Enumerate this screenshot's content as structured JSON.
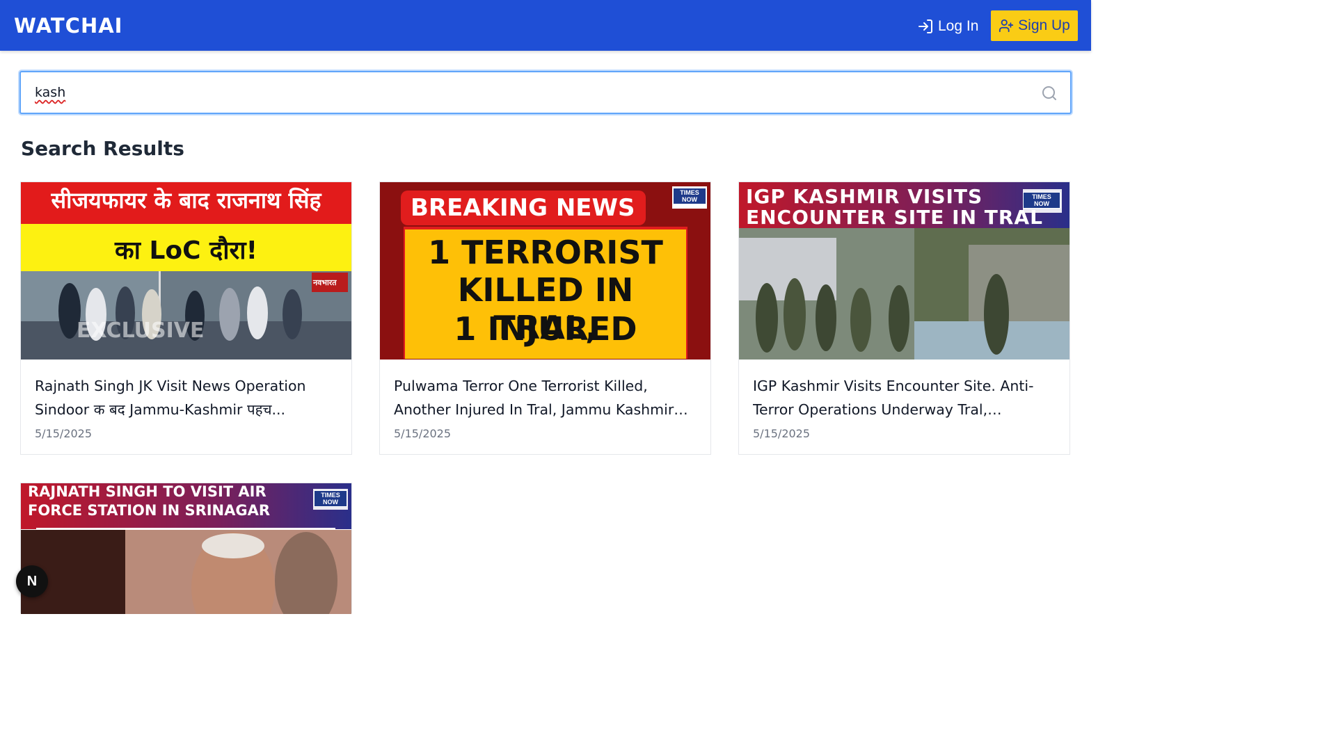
{
  "header": {
    "brand": "WATCHAI",
    "login_label": "Log In",
    "signup_label": "Sign Up"
  },
  "search": {
    "value": "kash",
    "placeholder": ""
  },
  "results_title": "Search Results",
  "results": [
    {
      "title": "Rajnath Singh JK Visit News Operation Sindoor क बद Jammu-Kashmir पहच...",
      "date": "5/15/2025",
      "thumb_line1": "सीजयफायर के बाद राजनाथ सिंह",
      "thumb_line2": "का LoC दौरा!",
      "thumb_watermark": "EXCLUSIVE",
      "thumb_logo": "नवभारत"
    },
    {
      "title": "Pulwama Terror One Terrorist Killed, Another Injured In Tral, Jammu Kashmir B...",
      "date": "5/15/2025",
      "thumb_banner": "BREAKING NEWS",
      "thumb_line1": "1 TERRORIST",
      "thumb_line2": "KILLED IN TRAL,",
      "thumb_line3": "1 INJURED",
      "thumb_logo": "TIMES NOW"
    },
    {
      "title": "IGP Kashmir Visits Encounter Site. Anti-Terror Operations Underway Tral, Pulwama.",
      "date": "5/15/2025",
      "thumb_line1": "IGP KASHMIR VISITS",
      "thumb_line2": "ENCOUNTER SITE IN TRAL",
      "thumb_logo": "TIMES NOW"
    },
    {
      "title": "",
      "date": "",
      "thumb_line1": "RAJNATH SINGH TO VISIT AIR",
      "thumb_line2": "FORCE STATION IN SRINAGAR",
      "thumb_logo": "TIMES NOW"
    }
  ],
  "floating_badge": "N",
  "colors": {
    "navbar": "#1f4fd6",
    "signup_bg": "#facc15",
    "focus_ring": "#60a5fa"
  }
}
